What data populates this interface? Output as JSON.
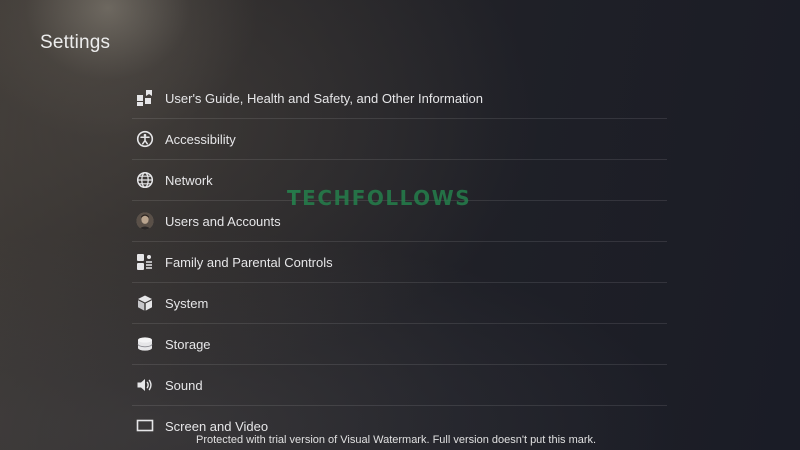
{
  "screen": {
    "title": "Settings"
  },
  "menu": {
    "items": [
      {
        "label": "User's Guide, Health and Safety, and Other Information",
        "icon": "users-guide-icon"
      },
      {
        "label": "Accessibility",
        "icon": "accessibility-icon"
      },
      {
        "label": "Network",
        "icon": "globe-icon"
      },
      {
        "label": "Users and Accounts",
        "icon": "user-avatar-icon"
      },
      {
        "label": "Family and Parental Controls",
        "icon": "family-controls-icon"
      },
      {
        "label": "System",
        "icon": "cube-icon"
      },
      {
        "label": "Storage",
        "icon": "storage-disk-icon"
      },
      {
        "label": "Sound",
        "icon": "speaker-icon"
      },
      {
        "label": "Screen and Video",
        "icon": "screen-icon"
      }
    ]
  },
  "watermark": {
    "logo_lead": "T",
    "logo_rest": "ECHFOLLOWS",
    "notice": "Protected with trial version of Visual Watermark. Full version doesn't put this mark.",
    "color": "#24844e"
  },
  "colors": {
    "text": "#e6e6e8",
    "divider": "rgba(255,255,255,0.10)"
  }
}
